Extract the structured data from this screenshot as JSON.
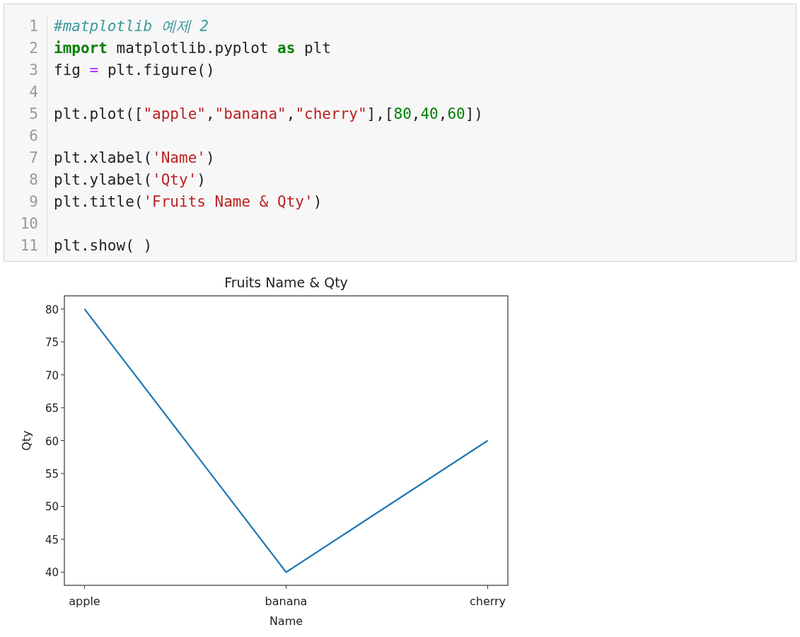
{
  "code_cell": {
    "lines": [
      {
        "number": "1",
        "tokens": [
          {
            "kind": "comment",
            "text": "#matplotlib 예제 2"
          }
        ]
      },
      {
        "number": "2",
        "tokens": [
          {
            "kind": "keyword",
            "text": "import"
          },
          {
            "kind": "plain",
            "text": " matplotlib.pyplot "
          },
          {
            "kind": "keyword",
            "text": "as"
          },
          {
            "kind": "plain",
            "text": " plt"
          }
        ]
      },
      {
        "number": "3",
        "tokens": [
          {
            "kind": "plain",
            "text": "fig "
          },
          {
            "kind": "operator",
            "text": "="
          },
          {
            "kind": "plain",
            "text": " plt.figure()"
          }
        ]
      },
      {
        "number": "4"
      },
      {
        "number": "5",
        "tokens": [
          {
            "kind": "plain",
            "text": "plt.plot(["
          },
          {
            "kind": "string",
            "text": "\"apple\""
          },
          {
            "kind": "plain",
            "text": ","
          },
          {
            "kind": "string",
            "text": "\"banana\""
          },
          {
            "kind": "plain",
            "text": ","
          },
          {
            "kind": "string",
            "text": "\"cherry\""
          },
          {
            "kind": "plain",
            "text": "],["
          },
          {
            "kind": "number",
            "text": "80"
          },
          {
            "kind": "plain",
            "text": ","
          },
          {
            "kind": "number",
            "text": "40"
          },
          {
            "kind": "plain",
            "text": ","
          },
          {
            "kind": "number",
            "text": "60"
          },
          {
            "kind": "plain",
            "text": "])"
          }
        ]
      },
      {
        "number": "6"
      },
      {
        "number": "7",
        "tokens": [
          {
            "kind": "plain",
            "text": "plt.xlabel("
          },
          {
            "kind": "string",
            "text": "'Name'"
          },
          {
            "kind": "plain",
            "text": ")"
          }
        ]
      },
      {
        "number": "8",
        "tokens": [
          {
            "kind": "plain",
            "text": "plt.ylabel("
          },
          {
            "kind": "string",
            "text": "'Qty'"
          },
          {
            "kind": "plain",
            "text": ")"
          }
        ]
      },
      {
        "number": "9",
        "tokens": [
          {
            "kind": "plain",
            "text": "plt.title("
          },
          {
            "kind": "string",
            "text": "'Fruits Name & Qty'"
          },
          {
            "kind": "plain",
            "text": ")"
          }
        ]
      },
      {
        "number": "10"
      },
      {
        "number": "11",
        "tokens": [
          {
            "kind": "plain",
            "text": "plt.show( )"
          }
        ]
      }
    ]
  },
  "output": {
    "chart_data": {
      "type": "line",
      "title": "Fruits Name & Qty",
      "xlabel": "Name",
      "ylabel": "Qty",
      "categories": [
        "apple",
        "banana",
        "cherry"
      ],
      "series": [
        {
          "color": "#1f77b4",
          "values": [
            80,
            40,
            60
          ]
        }
      ],
      "ylim": [
        38,
        82
      ],
      "yticks": [
        40,
        45,
        50,
        55,
        60,
        65,
        70,
        75,
        80
      ]
    }
  }
}
